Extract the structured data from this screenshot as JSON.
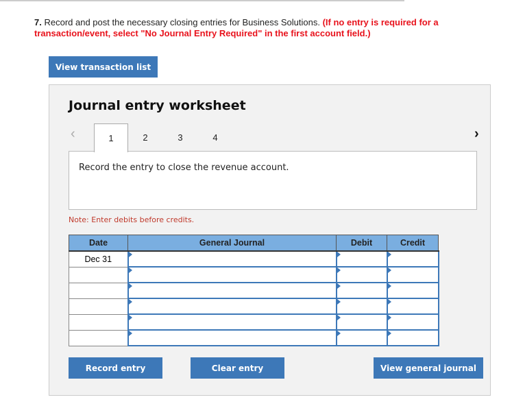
{
  "question": {
    "number": "7.",
    "text": "Record and post the necessary closing entries for Business Solutions.",
    "instruction": "(If no entry is required for a transaction/event, select \"No Journal Entry Required\" in the first account field.)"
  },
  "view_transaction_list": "View transaction list",
  "worksheet": {
    "title": "Journal entry worksheet",
    "tabs": [
      "1",
      "2",
      "3",
      "4"
    ],
    "active_tab": "1",
    "description": "Record the entry to close the revenue account.",
    "note": "Note: Enter debits before credits."
  },
  "table": {
    "headers": [
      "Date",
      "General Journal",
      "Debit",
      "Credit"
    ],
    "rows": [
      {
        "date": "Dec 31"
      },
      {
        "date": ""
      },
      {
        "date": ""
      },
      {
        "date": ""
      },
      {
        "date": ""
      },
      {
        "date": ""
      }
    ]
  },
  "buttons": {
    "record": "Record entry",
    "clear": "Clear entry",
    "view_journal": "View general journal"
  }
}
